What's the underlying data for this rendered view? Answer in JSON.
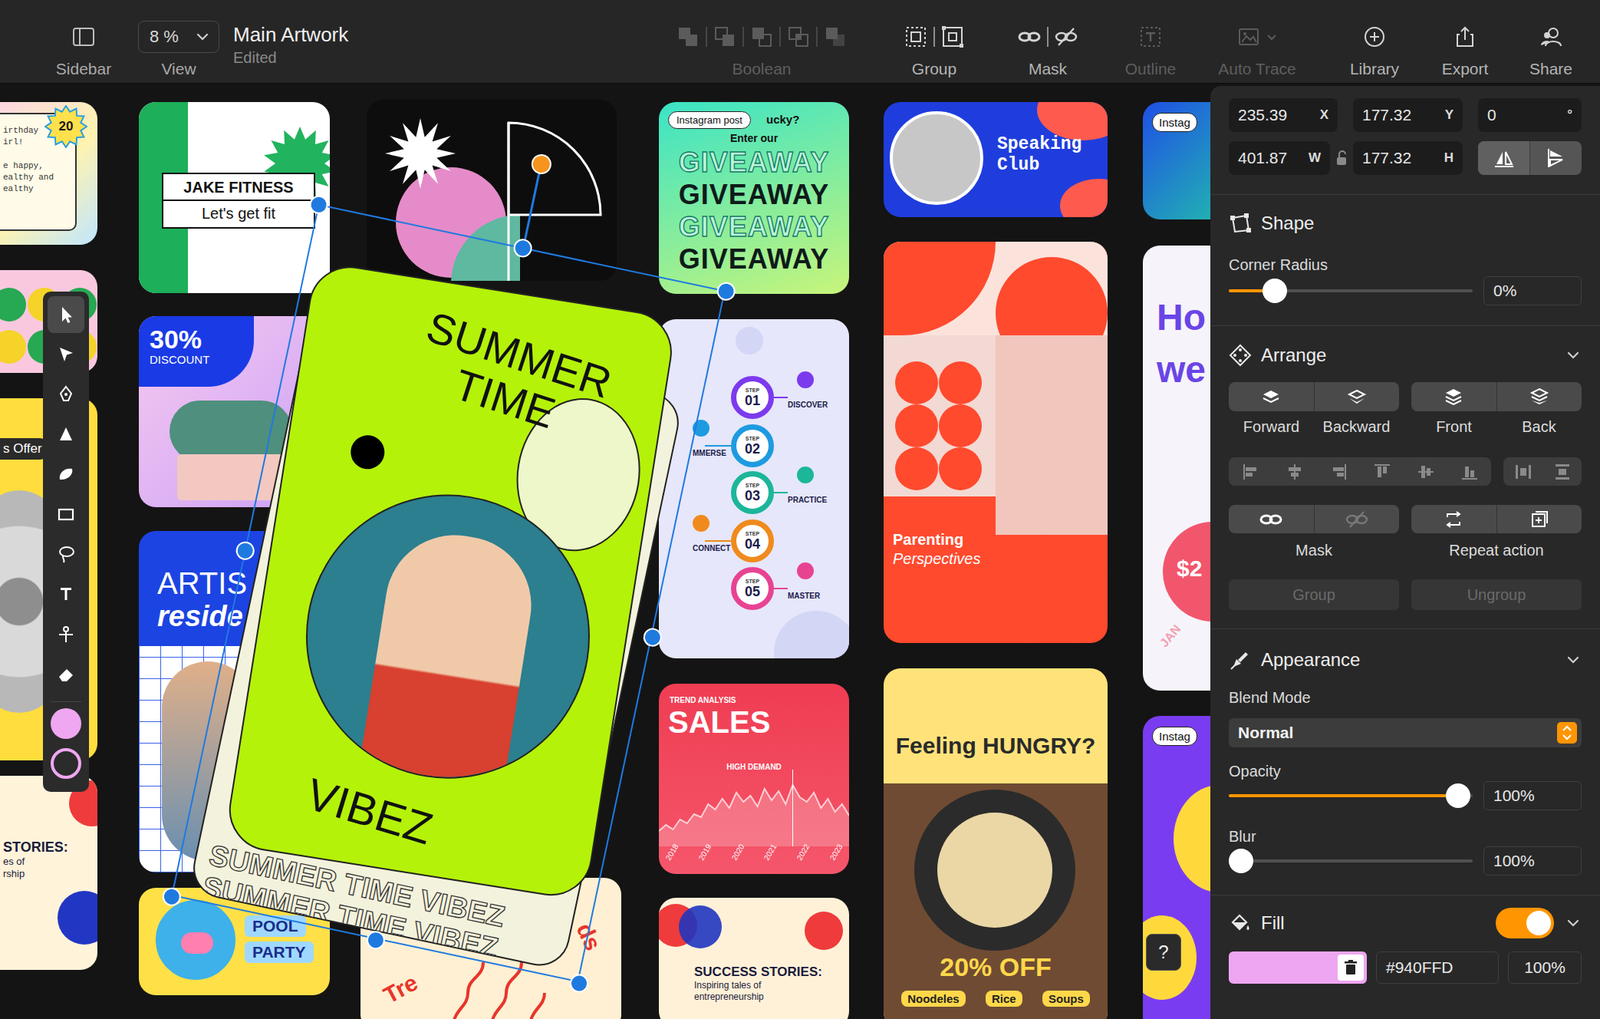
{
  "window": {
    "title": "Main Artwork",
    "status": "Edited"
  },
  "toolbar": {
    "sidebar": {
      "label": "Sidebar"
    },
    "view": {
      "value": "8 %",
      "label": "View"
    },
    "actions": [
      {
        "kind": "boolean",
        "label": "Boolean",
        "disabled": true
      },
      {
        "kind": "group",
        "label": "Group",
        "disabled": false
      },
      {
        "kind": "mask",
        "label": "Mask",
        "disabled": false
      },
      {
        "kind": "outline",
        "label": "Outline",
        "disabled": true
      },
      {
        "kind": "autotrace",
        "label": "Auto Trace",
        "disabled": true
      },
      {
        "kind": "library",
        "label": "Library",
        "disabled": false
      },
      {
        "kind": "export",
        "label": "Export",
        "disabled": false
      },
      {
        "kind": "share",
        "label": "Share",
        "disabled": false
      }
    ]
  },
  "tools": [
    {
      "kind": "select",
      "selected": true
    },
    {
      "kind": "direct",
      "selected": false
    },
    {
      "kind": "pen",
      "selected": false
    },
    {
      "kind": "nib",
      "selected": false
    },
    {
      "kind": "blob",
      "selected": false
    },
    {
      "kind": "rectangle",
      "selected": false
    },
    {
      "kind": "lasso",
      "selected": false
    },
    {
      "kind": "text",
      "selected": false
    },
    {
      "kind": "knife",
      "selected": false
    },
    {
      "kind": "eraser",
      "selected": false
    }
  ],
  "palette": {
    "fill_color": "#eea7f0",
    "stroke_color": "#eea7f0"
  },
  "canvas": {
    "cards": [
      {
        "kind": "birthday",
        "badge": "20",
        "lines": [
          "irthday",
          "irl!",
          "e happy,",
          "ealthy and",
          "ealthy"
        ]
      },
      {
        "kind": "dots"
      },
      {
        "kind": "offer",
        "label": "s Offer"
      },
      {
        "kind": "stories",
        "title": "STORIES:",
        "lines": [
          "es of",
          "rship"
        ]
      },
      {
        "kind": "fitness",
        "title": "JAKE FITNESS",
        "subtitle": "Let's get fit"
      },
      {
        "kind": "discount",
        "value": "30%",
        "label": "DISCOUNT"
      },
      {
        "kind": "artist",
        "lines": [
          "ARTIS",
          "reside"
        ]
      },
      {
        "kind": "pool",
        "lines": [
          "POOL",
          "PARTY"
        ]
      },
      {
        "kind": "shapes"
      },
      {
        "kind": "trends",
        "lines": [
          "Tre",
          "ds"
        ]
      },
      {
        "kind": "giveaway",
        "badge": "Instagram post",
        "kicker": "ucky?",
        "intro": "Enter our",
        "rows": [
          {
            "text": "GIVEAWAY",
            "outlined": true
          },
          {
            "text": "GIVEAWAY",
            "outlined": false
          },
          {
            "text": "GIVEAWAY",
            "outlined": true
          },
          {
            "text": "GIVEAWAY",
            "outlined": false
          }
        ]
      },
      {
        "kind": "steps",
        "steps": [
          {
            "prefix": "STEP",
            "num": "01",
            "label": "DISCOVER",
            "color": "#7c3aed"
          },
          {
            "prefix": "STEP",
            "num": "02",
            "label": "MMERSE",
            "color": "#1e9be0"
          },
          {
            "prefix": "STEP",
            "num": "03",
            "label": "PRACTICE",
            "color": "#1cb69a"
          },
          {
            "prefix": "STEP",
            "num": "04",
            "label": "CONNECT",
            "color": "#f08a1c"
          },
          {
            "prefix": "STEP",
            "num": "05",
            "label": "MASTER",
            "color": "#e84393"
          }
        ]
      },
      {
        "kind": "sales",
        "kicker": "TREND ANALYSIS",
        "title": "SALES",
        "note": "HIGH DEMAND",
        "years": [
          "2018",
          "2019",
          "2020",
          "2021",
          "2022",
          "2023"
        ],
        "series": [
          20,
          28,
          22,
          35,
          30,
          42,
          38,
          55,
          48,
          62,
          50,
          70,
          58,
          66,
          52,
          75,
          60,
          72,
          55,
          80,
          64,
          58,
          70,
          50,
          62,
          45,
          55,
          40
        ]
      },
      {
        "kind": "success",
        "title": "SUCCESS STORIES:",
        "lines": [
          "Inspiring tales of",
          "entrepreneurship"
        ]
      },
      {
        "kind": "speaking",
        "lines": [
          "Speaking",
          "Club"
        ]
      },
      {
        "kind": "parenting",
        "title": "Parenting",
        "subtitle": "Perspectives"
      },
      {
        "kind": "hungry",
        "title": "Feeling HUNGRY?",
        "offer": "20% OFF",
        "tags": [
          "Noodeles",
          "Rice",
          "Soups"
        ]
      },
      {
        "kind": "insta_top",
        "badge": "Instag"
      },
      {
        "kind": "price",
        "lines": [
          "Ho",
          "we"
        ],
        "price": "$2",
        "month": "JAN"
      },
      {
        "kind": "insta_bottom",
        "badge": "Instag"
      }
    ],
    "selection": {
      "title_lines": [
        "SUMMER",
        "TIME"
      ],
      "footer": "VIBEZ",
      "pattern": "SUMMER TIME VIBEZ"
    }
  },
  "inspector": {
    "transform": {
      "x": {
        "value": "235.39",
        "label": "X"
      },
      "y": {
        "value": "177.32",
        "label": "Y"
      },
      "rotation": {
        "value": "0",
        "label": "°"
      },
      "w": {
        "value": "401.87",
        "label": "W"
      },
      "h": {
        "value": "177.32",
        "label": "H"
      },
      "flip": [
        {
          "kind": "vertical"
        },
        {
          "kind": "horizontal"
        }
      ]
    },
    "shape": {
      "title": "Shape",
      "corner_radius": {
        "label": "Corner Radius",
        "level": 0.19,
        "value": "0%"
      }
    },
    "arrange": {
      "title": "Arrange",
      "expanded": true,
      "order": [
        {
          "kind": "forward",
          "label": "Forward"
        },
        {
          "kind": "backward",
          "label": "Backward"
        },
        {
          "kind": "front",
          "label": "Front"
        },
        {
          "kind": "back",
          "label": "Back"
        }
      ],
      "mask": {
        "label": "Mask"
      },
      "repeat": {
        "label": "Repeat action"
      },
      "group": {
        "label": "Group",
        "disabled": true
      },
      "ungroup": {
        "label": "Ungroup",
        "disabled": true
      }
    },
    "appearance": {
      "title": "Appearance",
      "expanded": true,
      "blend": {
        "label": "Blend Mode",
        "value": "Normal"
      },
      "opacity": {
        "label": "Opacity",
        "level": 0.94,
        "value": "100%"
      },
      "blur": {
        "label": "Blur",
        "level": 0.05,
        "value": "100%"
      }
    },
    "fill": {
      "title": "Fill",
      "on": true,
      "expanded": true,
      "color": "#efa6f2",
      "hex": "#940FFD",
      "opacity": "100%"
    }
  },
  "help": {
    "label": "?"
  }
}
